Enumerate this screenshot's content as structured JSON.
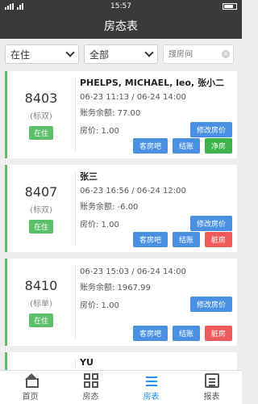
{
  "status_bar": {
    "time": "15:57"
  },
  "header": {
    "title": "房态表"
  },
  "filters": {
    "status": "在住",
    "category": "全部",
    "search_placeholder": "搜房间"
  },
  "rooms": [
    {
      "room": "8403",
      "type": "(标双)",
      "status": "在住",
      "guest": "PHELPS, MICHAEL, leo, 张小二",
      "dates": "06-23 11:13 / 06-24 14:00",
      "balance": "账务余额: 77.00",
      "price": "房价: 1.00",
      "edit_price_label": "修改房价",
      "action1": "客房吧",
      "action2": "结账",
      "action3": "净房",
      "action3_color": "#3cb44b"
    },
    {
      "room": "8407",
      "type": "(标双)",
      "status": "在住",
      "guest": "张三",
      "dates": "06-23 16:56 / 06-24 12:00",
      "balance": "账务余额: -6.00",
      "price": "房价: 1.00",
      "edit_price_label": "修改房价",
      "action1": "客房吧",
      "action2": "结账",
      "action3": "脏房",
      "action3_color": "#ef5a5a"
    },
    {
      "room": "8410",
      "type": "(标单)",
      "status": "在住",
      "guest": "",
      "dates": "06-23 15:03 / 06-24 14:00",
      "balance": "账务余额: 1967.99",
      "price": "房价: 1.00",
      "edit_price_label": "修改房价",
      "action1": "客房吧",
      "action2": "结账",
      "action3": "脏房",
      "action3_color": "#ef5a5a"
    },
    {
      "room": "",
      "type": "",
      "status": "",
      "guest": "YU",
      "dates": "",
      "balance": "",
      "price": "",
      "edit_price_label": "",
      "action1": "",
      "action2": "",
      "action3": "",
      "action3_color": "#ef5a5a"
    }
  ],
  "nav": {
    "items": [
      {
        "label": "首页",
        "icon": "home-icon"
      },
      {
        "label": "房态",
        "icon": "grid-icon"
      },
      {
        "label": "房表",
        "icon": "list-icon"
      },
      {
        "label": "报表",
        "icon": "doc-icon"
      }
    ],
    "active": "房表"
  }
}
